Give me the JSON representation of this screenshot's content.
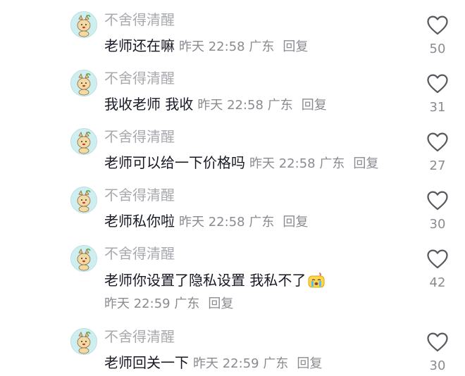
{
  "colors": {
    "text": "#161823",
    "muted": "#8a8b91",
    "username": "#a7a9ae",
    "avatar_bg": "#cfeef0"
  },
  "comments": [
    {
      "username": "不舍得清醒",
      "text": "老师还在嘛",
      "time": "昨天 22:58",
      "location": "广东",
      "reply": "回复",
      "likes": "50",
      "icon": "heart-outline-icon"
    },
    {
      "username": "不舍得清醒",
      "text": "我收老师 我收",
      "time": "昨天 22:58",
      "location": "广东",
      "reply": "回复",
      "likes": "31",
      "icon": "heart-outline-icon"
    },
    {
      "username": "不舍得清醒",
      "text": "老师可以给一下价格吗",
      "time": "昨天 22:58",
      "location": "广东",
      "reply": "回复",
      "likes": "27",
      "icon": "heart-outline-icon"
    },
    {
      "username": "不舍得清醒",
      "text": "老师私你啦",
      "time": "昨天 22:58",
      "location": "广东",
      "reply": "回复",
      "likes": "30",
      "icon": "heart-outline-icon"
    },
    {
      "username": "不舍得清醒",
      "text": "老师你设置了隐私设置 我私不了",
      "emoji": "crying-emoji",
      "time": "昨天 22:59",
      "location": "广东",
      "reply": "回复",
      "likes": "42",
      "icon": "heart-outline-icon"
    },
    {
      "username": "不舍得清醒",
      "text": "老师回关一下",
      "time": "昨天 22:59",
      "location": "广东",
      "reply": "回复",
      "likes": "30",
      "icon": "heart-outline-icon"
    }
  ]
}
